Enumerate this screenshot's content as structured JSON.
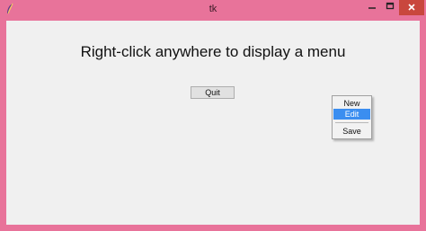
{
  "window": {
    "title": "tk",
    "frame_color": "#e8739a",
    "client_color": "#f0f0f0",
    "icons": {
      "app": "feather-icon",
      "minimize": "minimize-icon",
      "maximize": "maximize-icon",
      "close": "close-icon"
    }
  },
  "main": {
    "headline": "Right-click anywhere to display a menu",
    "quit_label": "Quit"
  },
  "context_menu": {
    "items": [
      {
        "label": "New",
        "highlighted": false
      },
      {
        "label": "Edit",
        "highlighted": true
      },
      {
        "label": "Save",
        "highlighted": false
      }
    ],
    "highlight_color": "#3b8ef0"
  }
}
